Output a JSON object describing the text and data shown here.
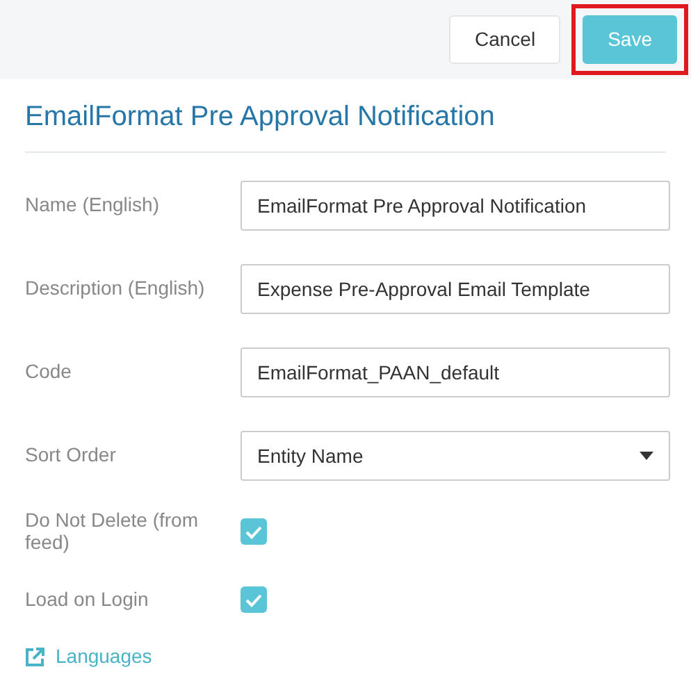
{
  "toolbar": {
    "buttons": [
      {
        "label": "Cancel",
        "kind": "secondary",
        "highlighted": false
      },
      {
        "label": "Save",
        "kind": "primary",
        "highlighted": true
      }
    ]
  },
  "title": "EmailFormat Pre Approval Notification",
  "fields": [
    {
      "kind": "text",
      "label": "Name (English)",
      "value": "EmailFormat Pre Approval Notification"
    },
    {
      "kind": "text",
      "label": "Description (English)",
      "value": "Expense Pre-Approval Email Template"
    },
    {
      "kind": "text",
      "label": "Code",
      "value": "EmailFormat_PAAN_default"
    },
    {
      "kind": "select",
      "label": "Sort Order",
      "value": "Entity Name"
    },
    {
      "kind": "checkbox",
      "label": "Do Not Delete (from feed)",
      "checked": true
    },
    {
      "kind": "checkbox",
      "label": "Load on Login",
      "checked": true
    }
  ],
  "link": {
    "label": "Languages"
  }
}
